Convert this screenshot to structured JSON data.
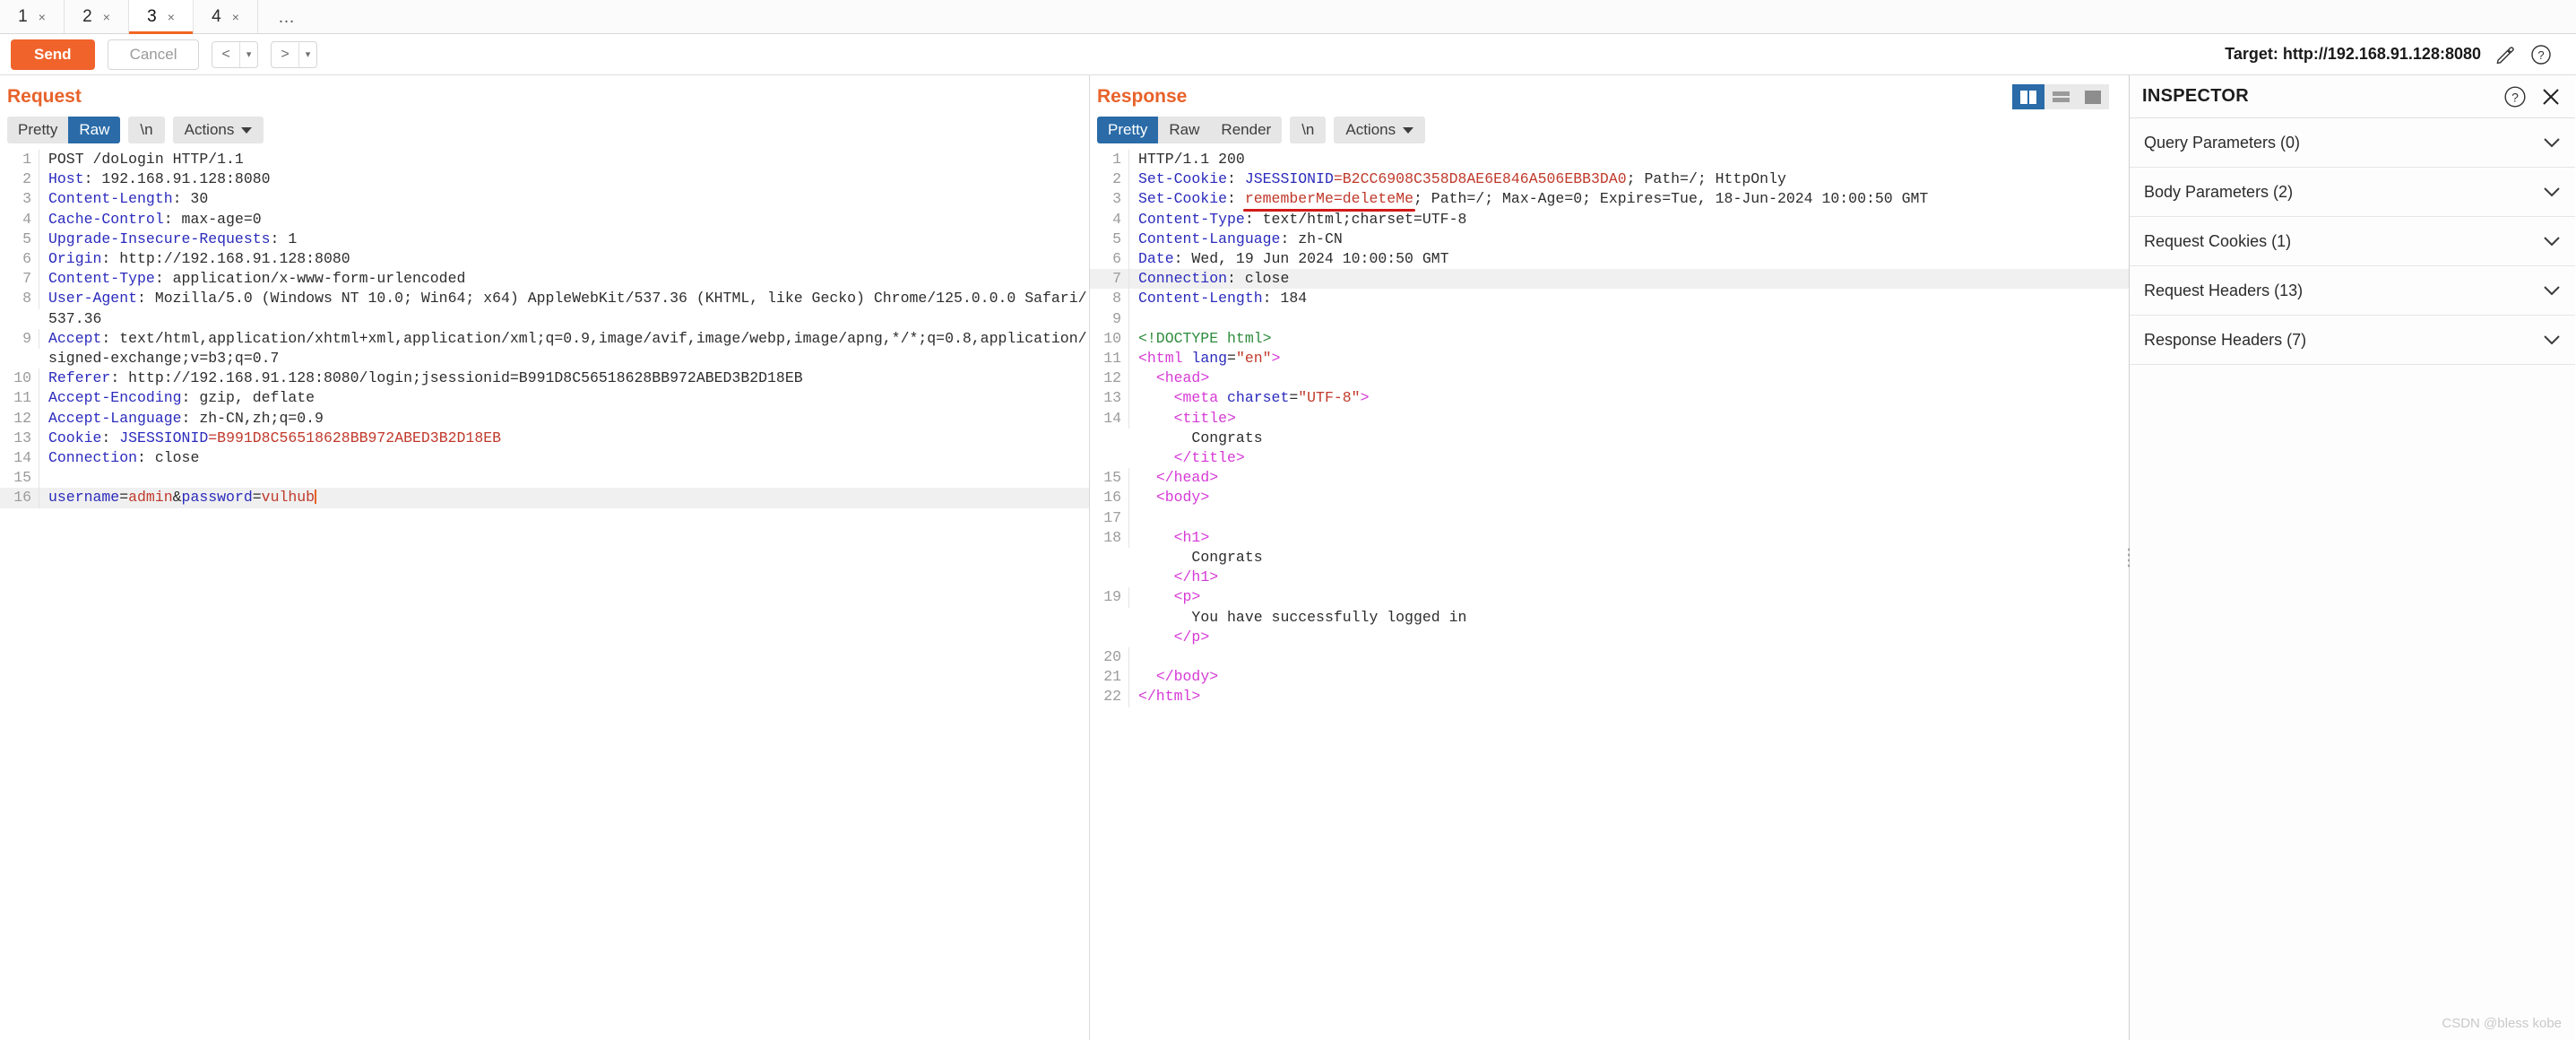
{
  "tabs": {
    "items": [
      {
        "label": "1",
        "close": "×",
        "active": false
      },
      {
        "label": "2",
        "close": "×",
        "active": false
      },
      {
        "label": "3",
        "close": "×",
        "active": true
      },
      {
        "label": "4",
        "close": "×",
        "active": false
      }
    ],
    "more": "…"
  },
  "actionbar": {
    "send_label": "Send",
    "cancel_label": "Cancel",
    "prev_label": "<",
    "next_label": ">",
    "prev_caret": "▾",
    "next_caret": "▾",
    "target_label": "Target: http://192.168.91.128:8080",
    "edit_icon": "pencil-icon",
    "help_icon": "help-icon"
  },
  "request": {
    "title": "Request",
    "tabs": [
      {
        "label": "Pretty",
        "active": false
      },
      {
        "label": "Raw",
        "active": true
      }
    ],
    "newline_label": "\\n",
    "actions_label": "Actions",
    "lines": [
      {
        "num": "1",
        "parts": [
          {
            "t": "POST /doLogin HTTP/1.1",
            "c": "plain"
          }
        ]
      },
      {
        "num": "2",
        "parts": [
          {
            "t": "Host",
            "c": "hdr"
          },
          {
            "t": ": 192.168.91.128:8080",
            "c": "plain"
          }
        ]
      },
      {
        "num": "3",
        "parts": [
          {
            "t": "Content-Length",
            "c": "hdr"
          },
          {
            "t": ": 30",
            "c": "plain"
          }
        ]
      },
      {
        "num": "4",
        "parts": [
          {
            "t": "Cache-Control",
            "c": "hdr"
          },
          {
            "t": ": max-age=0",
            "c": "plain"
          }
        ]
      },
      {
        "num": "5",
        "parts": [
          {
            "t": "Upgrade-Insecure-Requests",
            "c": "hdr"
          },
          {
            "t": ": 1",
            "c": "plain"
          }
        ]
      },
      {
        "num": "6",
        "parts": [
          {
            "t": "Origin",
            "c": "hdr"
          },
          {
            "t": ": http://192.168.91.128:8080",
            "c": "plain"
          }
        ]
      },
      {
        "num": "7",
        "parts": [
          {
            "t": "Content-Type",
            "c": "hdr"
          },
          {
            "t": ": application/x-www-form-urlencoded",
            "c": "plain"
          }
        ]
      },
      {
        "num": "8",
        "parts": [
          {
            "t": "User-Agent",
            "c": "hdr"
          },
          {
            "t": ": Mozilla/5.0 (Windows NT 10.0; Win64; x64) AppleWebKit/537.36 (KHTML, like Gecko) Chrome/125.0.0.0 Safari/537.36",
            "c": "plain"
          }
        ]
      },
      {
        "num": "9",
        "parts": [
          {
            "t": "Accept",
            "c": "hdr"
          },
          {
            "t": ": text/html,application/xhtml+xml,application/xml;q=0.9,image/avif,image/webp,image/apng,*/*;q=0.8,application/signed-exchange;v=b3;q=0.7",
            "c": "plain"
          }
        ]
      },
      {
        "num": "10",
        "parts": [
          {
            "t": "Referer",
            "c": "hdr"
          },
          {
            "t": ": http://192.168.91.128:8080/login;jsessionid=B991D8C56518628BB972ABED3B2D18EB",
            "c": "plain"
          }
        ]
      },
      {
        "num": "11",
        "parts": [
          {
            "t": "Accept-Encoding",
            "c": "hdr"
          },
          {
            "t": ": gzip, deflate",
            "c": "plain"
          }
        ]
      },
      {
        "num": "12",
        "parts": [
          {
            "t": "Accept-Language",
            "c": "hdr"
          },
          {
            "t": ": zh-CN,zh;q=0.9",
            "c": "plain"
          }
        ]
      },
      {
        "num": "13",
        "parts": [
          {
            "t": "Cookie",
            "c": "hdr"
          },
          {
            "t": ": ",
            "c": "plain"
          },
          {
            "t": "JSESSIONID",
            "c": "blue"
          },
          {
            "t": "=B991D8C56518628BB972ABED3B2D18EB",
            "c": "red"
          }
        ]
      },
      {
        "num": "14",
        "parts": [
          {
            "t": "Connection",
            "c": "hdr"
          },
          {
            "t": ": close",
            "c": "plain"
          }
        ]
      },
      {
        "num": "15",
        "parts": [
          {
            "t": "",
            "c": "plain"
          }
        ]
      },
      {
        "num": "16",
        "highlight": true,
        "cursor": true,
        "parts": [
          {
            "t": "username",
            "c": "blue"
          },
          {
            "t": "=",
            "c": "plain"
          },
          {
            "t": "admin",
            "c": "red"
          },
          {
            "t": "&",
            "c": "plain"
          },
          {
            "t": "password",
            "c": "blue"
          },
          {
            "t": "=",
            "c": "plain"
          },
          {
            "t": "vulhub",
            "c": "red"
          }
        ]
      }
    ]
  },
  "response": {
    "title": "Response",
    "tabs": [
      {
        "label": "Pretty",
        "active": true
      },
      {
        "label": "Raw",
        "active": false
      },
      {
        "label": "Render",
        "active": false
      }
    ],
    "newline_label": "\\n",
    "actions_label": "Actions",
    "layout_buttons": [
      {
        "name": "side-by-side-layout-button",
        "active": true
      },
      {
        "name": "stacked-layout-button",
        "active": false
      },
      {
        "name": "single-pane-layout-button",
        "active": false
      }
    ],
    "lines": [
      {
        "num": "1",
        "parts": [
          {
            "t": "HTTP/1.1 200",
            "c": "plain"
          }
        ]
      },
      {
        "num": "2",
        "parts": [
          {
            "t": "Set-Cookie",
            "c": "hdr"
          },
          {
            "t": ": ",
            "c": "plain"
          },
          {
            "t": "JSESSIONID",
            "c": "blue"
          },
          {
            "t": "=B2CC6908C358D8AE6E846A506EBB3DA0",
            "c": "red"
          },
          {
            "t": "; Path=/; HttpOnly",
            "c": "plain"
          }
        ]
      },
      {
        "num": "3",
        "annotated": true,
        "parts": [
          {
            "t": "Set-Cookie",
            "c": "hdr"
          },
          {
            "t": ": ",
            "c": "plain"
          },
          {
            "t": "rememberMe",
            "c": "red",
            "annot": true
          },
          {
            "t": "=",
            "c": "red",
            "annot": true
          },
          {
            "t": "deleteMe",
            "c": "red",
            "annot": true
          },
          {
            "t": "; Path=/; Max-Age=0; Expires=Tue, 18-Jun-2024 10:00:50 GMT",
            "c": "plain"
          }
        ]
      },
      {
        "num": "4",
        "parts": [
          {
            "t": "Content-Type",
            "c": "hdr"
          },
          {
            "t": ": text/html;charset=UTF-8",
            "c": "plain"
          }
        ]
      },
      {
        "num": "5",
        "parts": [
          {
            "t": "Content-Language",
            "c": "hdr"
          },
          {
            "t": ": zh-CN",
            "c": "plain"
          }
        ]
      },
      {
        "num": "6",
        "parts": [
          {
            "t": "Date",
            "c": "hdr"
          },
          {
            "t": ": Wed, 19 Jun 2024 10:00:50 GMT",
            "c": "plain"
          }
        ]
      },
      {
        "num": "7",
        "highlight": true,
        "parts": [
          {
            "t": "Connection",
            "c": "hdr"
          },
          {
            "t": ": close",
            "c": "plain"
          }
        ]
      },
      {
        "num": "8",
        "parts": [
          {
            "t": "Content-Length",
            "c": "hdr"
          },
          {
            "t": ": 184",
            "c": "plain"
          }
        ]
      },
      {
        "num": "9",
        "parts": [
          {
            "t": "",
            "c": "plain"
          }
        ]
      },
      {
        "num": "10",
        "parts": [
          {
            "t": "<!DOCTYPE html>",
            "c": "dtd"
          }
        ]
      },
      {
        "num": "11",
        "parts": [
          {
            "t": "<html ",
            "c": "tag"
          },
          {
            "t": "lang",
            "c": "attr"
          },
          {
            "t": "=",
            "c": "plain"
          },
          {
            "t": "\"en\"",
            "c": "aval"
          },
          {
            "t": ">",
            "c": "tag"
          }
        ]
      },
      {
        "num": "12",
        "parts": [
          {
            "t": "  <head>",
            "c": "tag"
          }
        ]
      },
      {
        "num": "13",
        "parts": [
          {
            "t": "    <meta ",
            "c": "tag"
          },
          {
            "t": "charset",
            "c": "attr"
          },
          {
            "t": "=",
            "c": "plain"
          },
          {
            "t": "\"UTF-8\"",
            "c": "aval"
          },
          {
            "t": ">",
            "c": "tag"
          }
        ]
      },
      {
        "num": "14",
        "parts": [
          {
            "t": "    <title>",
            "c": "tag"
          }
        ]
      },
      {
        "num": "",
        "parts": [
          {
            "t": "      Congrats",
            "c": "plain"
          }
        ]
      },
      {
        "num": "",
        "parts": [
          {
            "t": "    </title>",
            "c": "tag"
          }
        ]
      },
      {
        "num": "15",
        "parts": [
          {
            "t": "  </head>",
            "c": "tag"
          }
        ]
      },
      {
        "num": "16",
        "parts": [
          {
            "t": "  <body>",
            "c": "tag"
          }
        ]
      },
      {
        "num": "17",
        "parts": [
          {
            "t": "",
            "c": "plain"
          }
        ]
      },
      {
        "num": "18",
        "parts": [
          {
            "t": "    <h1>",
            "c": "tag"
          }
        ]
      },
      {
        "num": "",
        "parts": [
          {
            "t": "      Congrats",
            "c": "plain"
          }
        ]
      },
      {
        "num": "",
        "parts": [
          {
            "t": "    </h1>",
            "c": "tag"
          }
        ]
      },
      {
        "num": "19",
        "parts": [
          {
            "t": "    <p>",
            "c": "tag"
          }
        ]
      },
      {
        "num": "",
        "parts": [
          {
            "t": "      You have successfully logged in",
            "c": "plain"
          }
        ]
      },
      {
        "num": "",
        "parts": [
          {
            "t": "    </p>",
            "c": "tag"
          }
        ]
      },
      {
        "num": "20",
        "parts": [
          {
            "t": "",
            "c": "plain"
          }
        ]
      },
      {
        "num": "21",
        "parts": [
          {
            "t": "  </body>",
            "c": "tag"
          }
        ]
      },
      {
        "num": "22",
        "parts": [
          {
            "t": "</html>",
            "c": "tag"
          }
        ]
      }
    ]
  },
  "inspector": {
    "title": "INSPECTOR",
    "help_icon": "help-icon",
    "close_icon": "close-icon",
    "sections": [
      {
        "label": "Query Parameters (0)",
        "chevron": "⌄"
      },
      {
        "label": "Body Parameters (2)",
        "chevron": "⌄"
      },
      {
        "label": "Request Cookies (1)",
        "chevron": "⌄"
      },
      {
        "label": "Request Headers (13)",
        "chevron": "⌄"
      },
      {
        "label": "Response Headers (7)",
        "chevron": "⌄"
      }
    ]
  },
  "watermark": "CSDN @bless kobe",
  "colors": {
    "accent_orange": "#f0632b",
    "active_blue": "#2a6ba8",
    "header_blue": "#2b2bbd",
    "value_red": "#c0392b",
    "tag_magenta": "#d63ad6",
    "doctype_green": "#2e8b3d",
    "annotation_red": "#d21a1a"
  }
}
